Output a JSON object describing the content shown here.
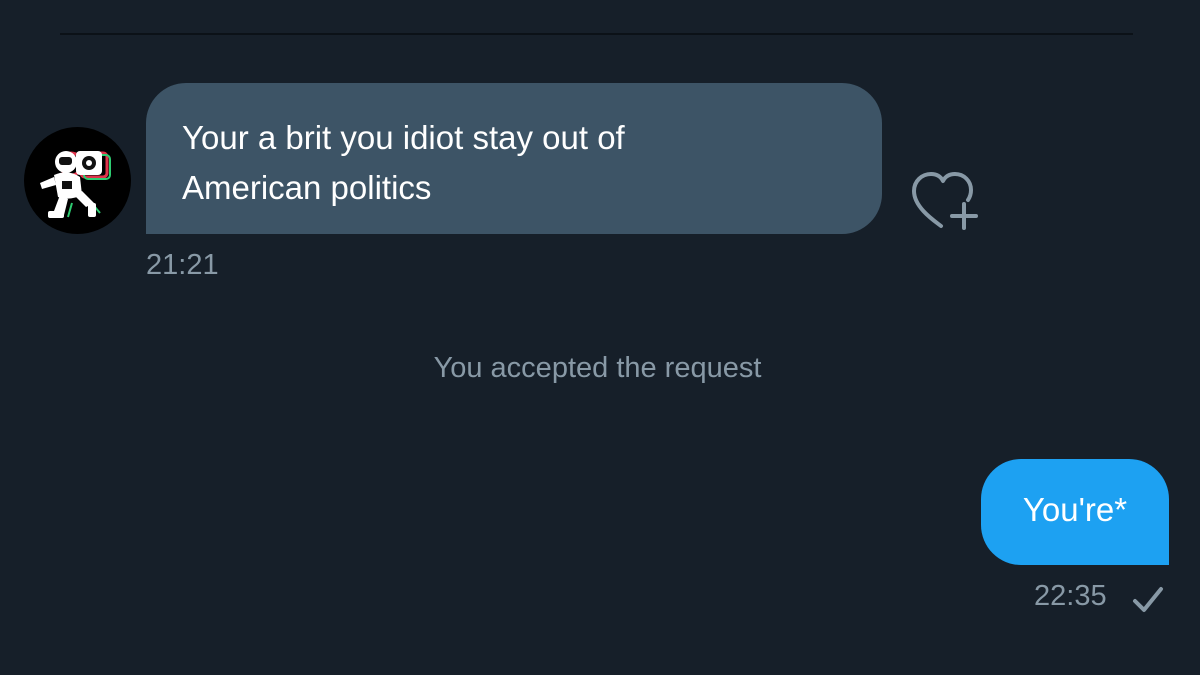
{
  "conversation": {
    "incoming": {
      "text": "Your a brit you idiot stay out of\nAmerican politics",
      "time": "21:21",
      "avatar_icon": "astronaut-avatar-icon",
      "like_icon": "heart-plus-icon"
    },
    "system_note": "You accepted the request",
    "outgoing": {
      "text": "You're*",
      "time": "22:35",
      "status_icon": "checkmark-icon"
    }
  },
  "colors": {
    "background": "#161f29",
    "incoming_bubble": "#3d5466",
    "outgoing_bubble": "#1da1f2",
    "muted_text": "#8899a6"
  }
}
